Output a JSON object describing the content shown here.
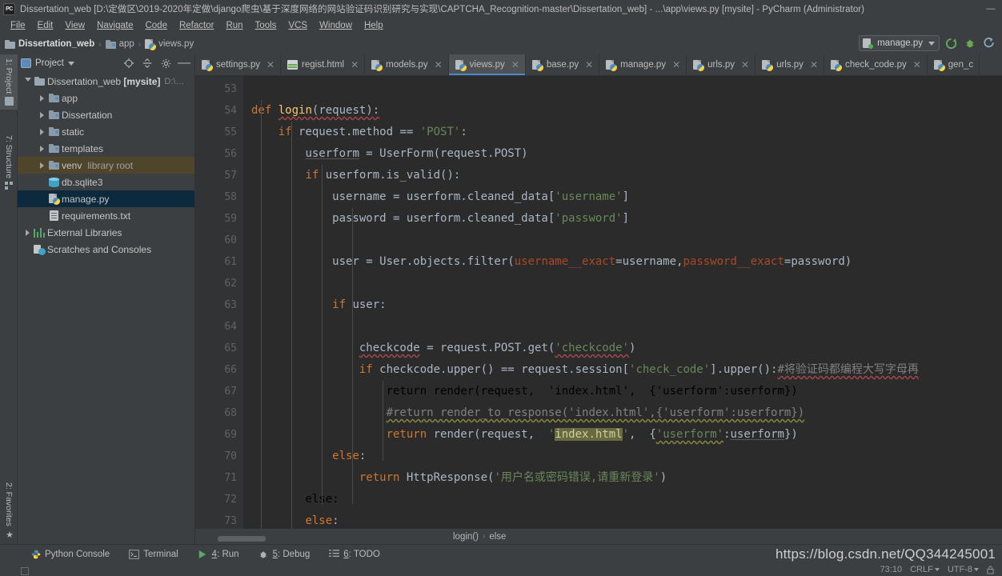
{
  "window": {
    "title": "Dissertation_web [D:\\定做区\\2019-2020年定做\\django爬虫\\基于深度网络的网站验证码识别研究与实现\\CAPTCHA_Recognition-master\\Dissertation_web] - ...\\app\\views.py [mysite] - PyCharm (Administrator)",
    "logo": "PC",
    "minimize": "—",
    "maximize": "❐",
    "close": "✕"
  },
  "menubar": {
    "items": [
      {
        "label": "File"
      },
      {
        "label": "Edit"
      },
      {
        "label": "View"
      },
      {
        "label": "Navigate"
      },
      {
        "label": "Code"
      },
      {
        "label": "Refactor"
      },
      {
        "label": "Run"
      },
      {
        "label": "Tools"
      },
      {
        "label": "VCS"
      },
      {
        "label": "Window"
      },
      {
        "label": "Help"
      }
    ]
  },
  "navbar": {
    "breadcrumbs": [
      {
        "label": "Dissertation_web",
        "icon": "folder-icon"
      },
      {
        "label": "app",
        "icon": "source-folder-icon"
      },
      {
        "label": "views.py",
        "icon": "python-file-icon"
      }
    ],
    "separator": "›",
    "run_config": {
      "label": "manage.py",
      "icon": "run-config-icon"
    },
    "buttons": [
      {
        "name": "run-button",
        "glyph": "▶"
      },
      {
        "name": "debug-button",
        "glyph": "☢"
      },
      {
        "name": "coverage-button",
        "glyph": "↻"
      }
    ]
  },
  "left_strip": {
    "tabs": [
      {
        "label": "1: Project",
        "active": true,
        "icon": "folder-icon"
      },
      {
        "label": "7: Structure",
        "active": false,
        "icon": "structure-icon"
      },
      {
        "label": "2: Favorites",
        "active": false,
        "icon": "star-icon"
      }
    ]
  },
  "project_panel": {
    "title": "Project",
    "header_buttons": [
      {
        "name": "locate-button",
        "glyph": "⊕"
      },
      {
        "name": "collapse-all-button",
        "glyph": "≡"
      },
      {
        "name": "settings-button",
        "glyph": "⚙"
      },
      {
        "name": "hide-button",
        "glyph": "—"
      }
    ],
    "tree": [
      {
        "label": "Dissertation_web",
        "bold_part": "[mysite]",
        "path": "D:\\…",
        "indent": 0,
        "arrow": "open",
        "icon": "folder-icon",
        "state": "normal"
      },
      {
        "label": "app",
        "indent": 1,
        "arrow": "closed",
        "icon": "source-folder-icon",
        "state": "normal"
      },
      {
        "label": "Dissertation",
        "indent": 1,
        "arrow": "closed",
        "icon": "source-folder-icon",
        "state": "normal"
      },
      {
        "label": "static",
        "indent": 1,
        "arrow": "closed",
        "icon": "source-folder-icon",
        "state": "normal"
      },
      {
        "label": "templates",
        "indent": 1,
        "arrow": "closed",
        "icon": "source-folder-icon",
        "state": "normal"
      },
      {
        "label": "venv",
        "suffix": "library root",
        "indent": 1,
        "arrow": "closed",
        "icon": "source-folder-icon",
        "state": "highlight"
      },
      {
        "label": "db.sqlite3",
        "indent": 1,
        "arrow": "none",
        "icon": "database-icon",
        "state": "normal"
      },
      {
        "label": "manage.py",
        "indent": 1,
        "arrow": "none",
        "icon": "python-file-icon",
        "state": "selected"
      },
      {
        "label": "requirements.txt",
        "indent": 1,
        "arrow": "none",
        "icon": "text-file-icon",
        "state": "normal"
      },
      {
        "label": "External Libraries",
        "indent": 0,
        "arrow": "closed",
        "icon": "library-icon",
        "state": "normal"
      },
      {
        "label": "Scratches and Consoles",
        "indent": 0,
        "arrow": "none",
        "icon": "scratches-icon",
        "state": "normal"
      }
    ]
  },
  "editor": {
    "tabs": [
      {
        "label": "settings.py",
        "icon": "python-file-icon",
        "active": false,
        "close": "✕"
      },
      {
        "label": "regist.html",
        "icon": "html-file-icon",
        "active": false,
        "close": "✕"
      },
      {
        "label": "models.py",
        "icon": "python-file-icon",
        "active": false,
        "close": "✕"
      },
      {
        "label": "views.py",
        "icon": "python-file-icon",
        "active": true,
        "close": "✕"
      },
      {
        "label": "base.py",
        "icon": "python-file-icon",
        "active": false,
        "close": "✕"
      },
      {
        "label": "manage.py",
        "icon": "python-file-icon",
        "active": false,
        "close": "✕"
      },
      {
        "label": "urls.py",
        "icon": "python-file-icon",
        "active": false,
        "close": "✕"
      },
      {
        "label": "urls.py",
        "icon": "python-file-icon",
        "active": false,
        "close": "✕"
      },
      {
        "label": "check_code.py",
        "icon": "python-file-icon",
        "active": false,
        "close": "✕"
      },
      {
        "label": "gen_c",
        "icon": "python-file-icon",
        "active": false,
        "close": ""
      }
    ],
    "first_line_number": 53,
    "lines": [
      {
        "num": "53",
        "text": ""
      },
      {
        "num": "54",
        "text": "def login(request):"
      },
      {
        "num": "55",
        "text": "    if request.method == 'POST':"
      },
      {
        "num": "56",
        "text": "        userform = UserForm(request.POST)"
      },
      {
        "num": "57",
        "text": "        if userform.is_valid():"
      },
      {
        "num": "58",
        "text": "            username = userform.cleaned_data['username']"
      },
      {
        "num": "59",
        "text": "            password = userform.cleaned_data['password']"
      },
      {
        "num": "60",
        "text": ""
      },
      {
        "num": "61",
        "text": "            user = User.objects.filter(username__exact=username,password__exact=password)"
      },
      {
        "num": "62",
        "text": ""
      },
      {
        "num": "63",
        "text": "            if user:"
      },
      {
        "num": "64",
        "text": ""
      },
      {
        "num": "65",
        "text": "                checkcode = request.POST.get('checkcode')"
      },
      {
        "num": "66",
        "text": "                if checkcode.upper() == request.session['check_code'].upper():#将验证码都编程大写字母再"
      },
      {
        "num": "67",
        "text": ""
      },
      {
        "num": "68",
        "text": "                    #return render_to_response('index.html',{'userform':userform})"
      },
      {
        "num": "69",
        "text": "                    return render(request,  'index.html',  {'userform':userform})"
      },
      {
        "num": "70",
        "text": "            else:"
      },
      {
        "num": "71",
        "text": "                return HttpResponse('用户名或密码错误,请重新登录')"
      },
      {
        "num": "72",
        "text": ""
      },
      {
        "num": "73",
        "text": "        else:"
      }
    ],
    "breadcrumb": {
      "items": [
        {
          "label": "login()"
        },
        {
          "label": "else"
        }
      ],
      "separator": "›"
    }
  },
  "bottom_toolwindows": [
    {
      "label": "Python Console",
      "icon": "python-icon",
      "mnemonic": ""
    },
    {
      "label": "Terminal",
      "icon": "terminal-icon",
      "mnemonic": ""
    },
    {
      "label": "4: Run",
      "icon": "run-icon",
      "mnemonic": "4"
    },
    {
      "label": "5: Debug",
      "icon": "debug-icon",
      "mnemonic": "5"
    },
    {
      "label": "6: TODO",
      "icon": "todo-icon",
      "mnemonic": "6"
    }
  ],
  "statusbar": {
    "caret_position": "73:10",
    "line_separator": "CRLF",
    "encoding": "UTF-8",
    "lock_icon": "lock-icon"
  },
  "watermark": {
    "text": "https://blog.csdn.net/QQ344245001"
  },
  "colors": {
    "editor_bg": "#2b2b2b",
    "gutter_bg": "#313335",
    "panel_bg": "#3c3f41",
    "tab_active_bg": "#4e5254",
    "tab_underline": "#4a88c7",
    "selection_bg": "#0d293e",
    "highlight_row": "#4f452a",
    "keyword": "#cc7832",
    "function": "#ffc66d",
    "string": "#6a8759",
    "comment": "#808080",
    "kwarg": "#aa4926",
    "plain_text": "#a9b7c6"
  }
}
